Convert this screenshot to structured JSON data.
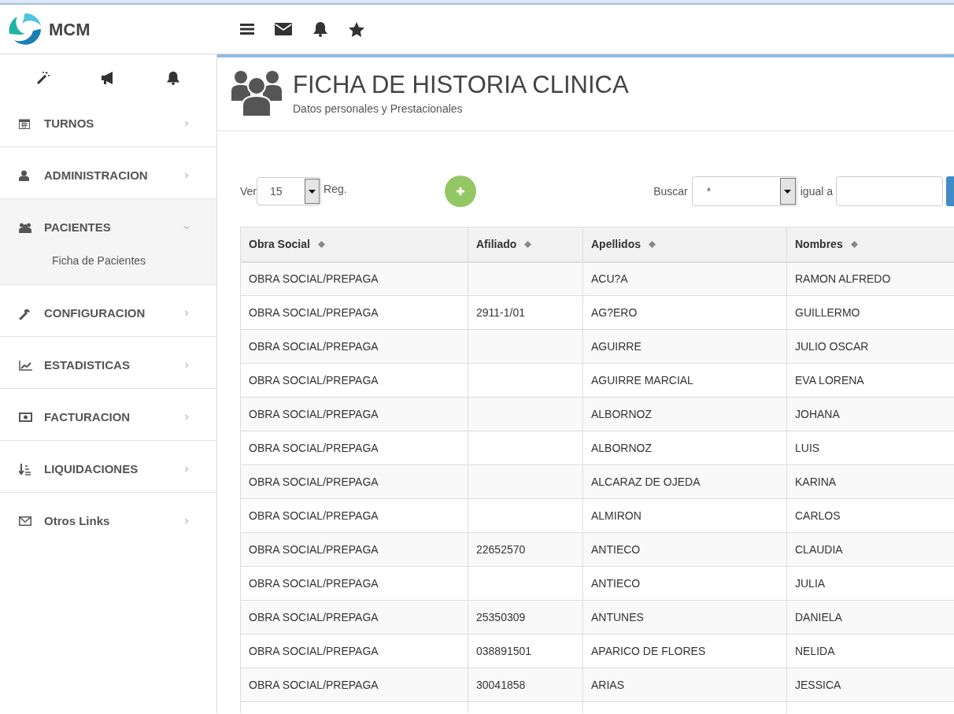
{
  "brand": {
    "name": "MCM"
  },
  "page": {
    "title": "FICHA DE HISTORIA CLINICA",
    "subtitle": "Datos personales y Prestacionales"
  },
  "sidebar": {
    "items": [
      {
        "label": "TURNOS",
        "expanded": false
      },
      {
        "label": "ADMINISTRACION",
        "expanded": false
      },
      {
        "label": "PACIENTES",
        "expanded": true,
        "children": [
          {
            "label": "Ficha de Pacientes"
          }
        ]
      },
      {
        "label": "CONFIGURACION",
        "expanded": false
      },
      {
        "label": "ESTADISTICAS",
        "expanded": false
      },
      {
        "label": "FACTURACION",
        "expanded": false
      },
      {
        "label": "LIQUIDACIONES",
        "expanded": false
      },
      {
        "label": "Otros Links",
        "expanded": false
      }
    ]
  },
  "controls": {
    "show_label": "Ver",
    "page_size": "15",
    "records_label": "Reg.",
    "search_label": "Buscar",
    "search_field": "*",
    "equals_label": "igual a"
  },
  "table": {
    "columns": [
      "Obra Social",
      "Afiliado",
      "Apellidos",
      "Nombres"
    ],
    "rows": [
      [
        "OBRA SOCIAL/PREPAGA",
        "",
        "ACU?A",
        "RAMON ALFREDO"
      ],
      [
        "OBRA SOCIAL/PREPAGA",
        "2911-1/01",
        "AG?ERO",
        "GUILLERMO"
      ],
      [
        "OBRA SOCIAL/PREPAGA",
        "",
        "AGUIRRE",
        "JULIO OSCAR"
      ],
      [
        "OBRA SOCIAL/PREPAGA",
        "",
        "AGUIRRE MARCIAL",
        "EVA LORENA"
      ],
      [
        "OBRA SOCIAL/PREPAGA",
        "",
        "ALBORNOZ",
        "JOHANA"
      ],
      [
        "OBRA SOCIAL/PREPAGA",
        "",
        "ALBORNOZ",
        "LUIS"
      ],
      [
        "OBRA SOCIAL/PREPAGA",
        "",
        "ALCARAZ DE OJEDA",
        "KARINA"
      ],
      [
        "OBRA SOCIAL/PREPAGA",
        "",
        "ALMIRON",
        "CARLOS"
      ],
      [
        "OBRA SOCIAL/PREPAGA",
        "22652570",
        "ANTIECO",
        "CLAUDIA"
      ],
      [
        "OBRA SOCIAL/PREPAGA",
        "",
        "ANTIECO",
        "JULIA"
      ],
      [
        "OBRA SOCIAL/PREPAGA",
        "25350309",
        "ANTUNES",
        "DANIELA"
      ],
      [
        "OBRA SOCIAL/PREPAGA",
        "038891501",
        "APARICO DE FLORES",
        "NELIDA"
      ],
      [
        "OBRA SOCIAL/PREPAGA",
        "30041858",
        "ARIAS",
        "JESSICA"
      ],
      [
        "",
        "",
        "",
        ""
      ]
    ]
  }
}
